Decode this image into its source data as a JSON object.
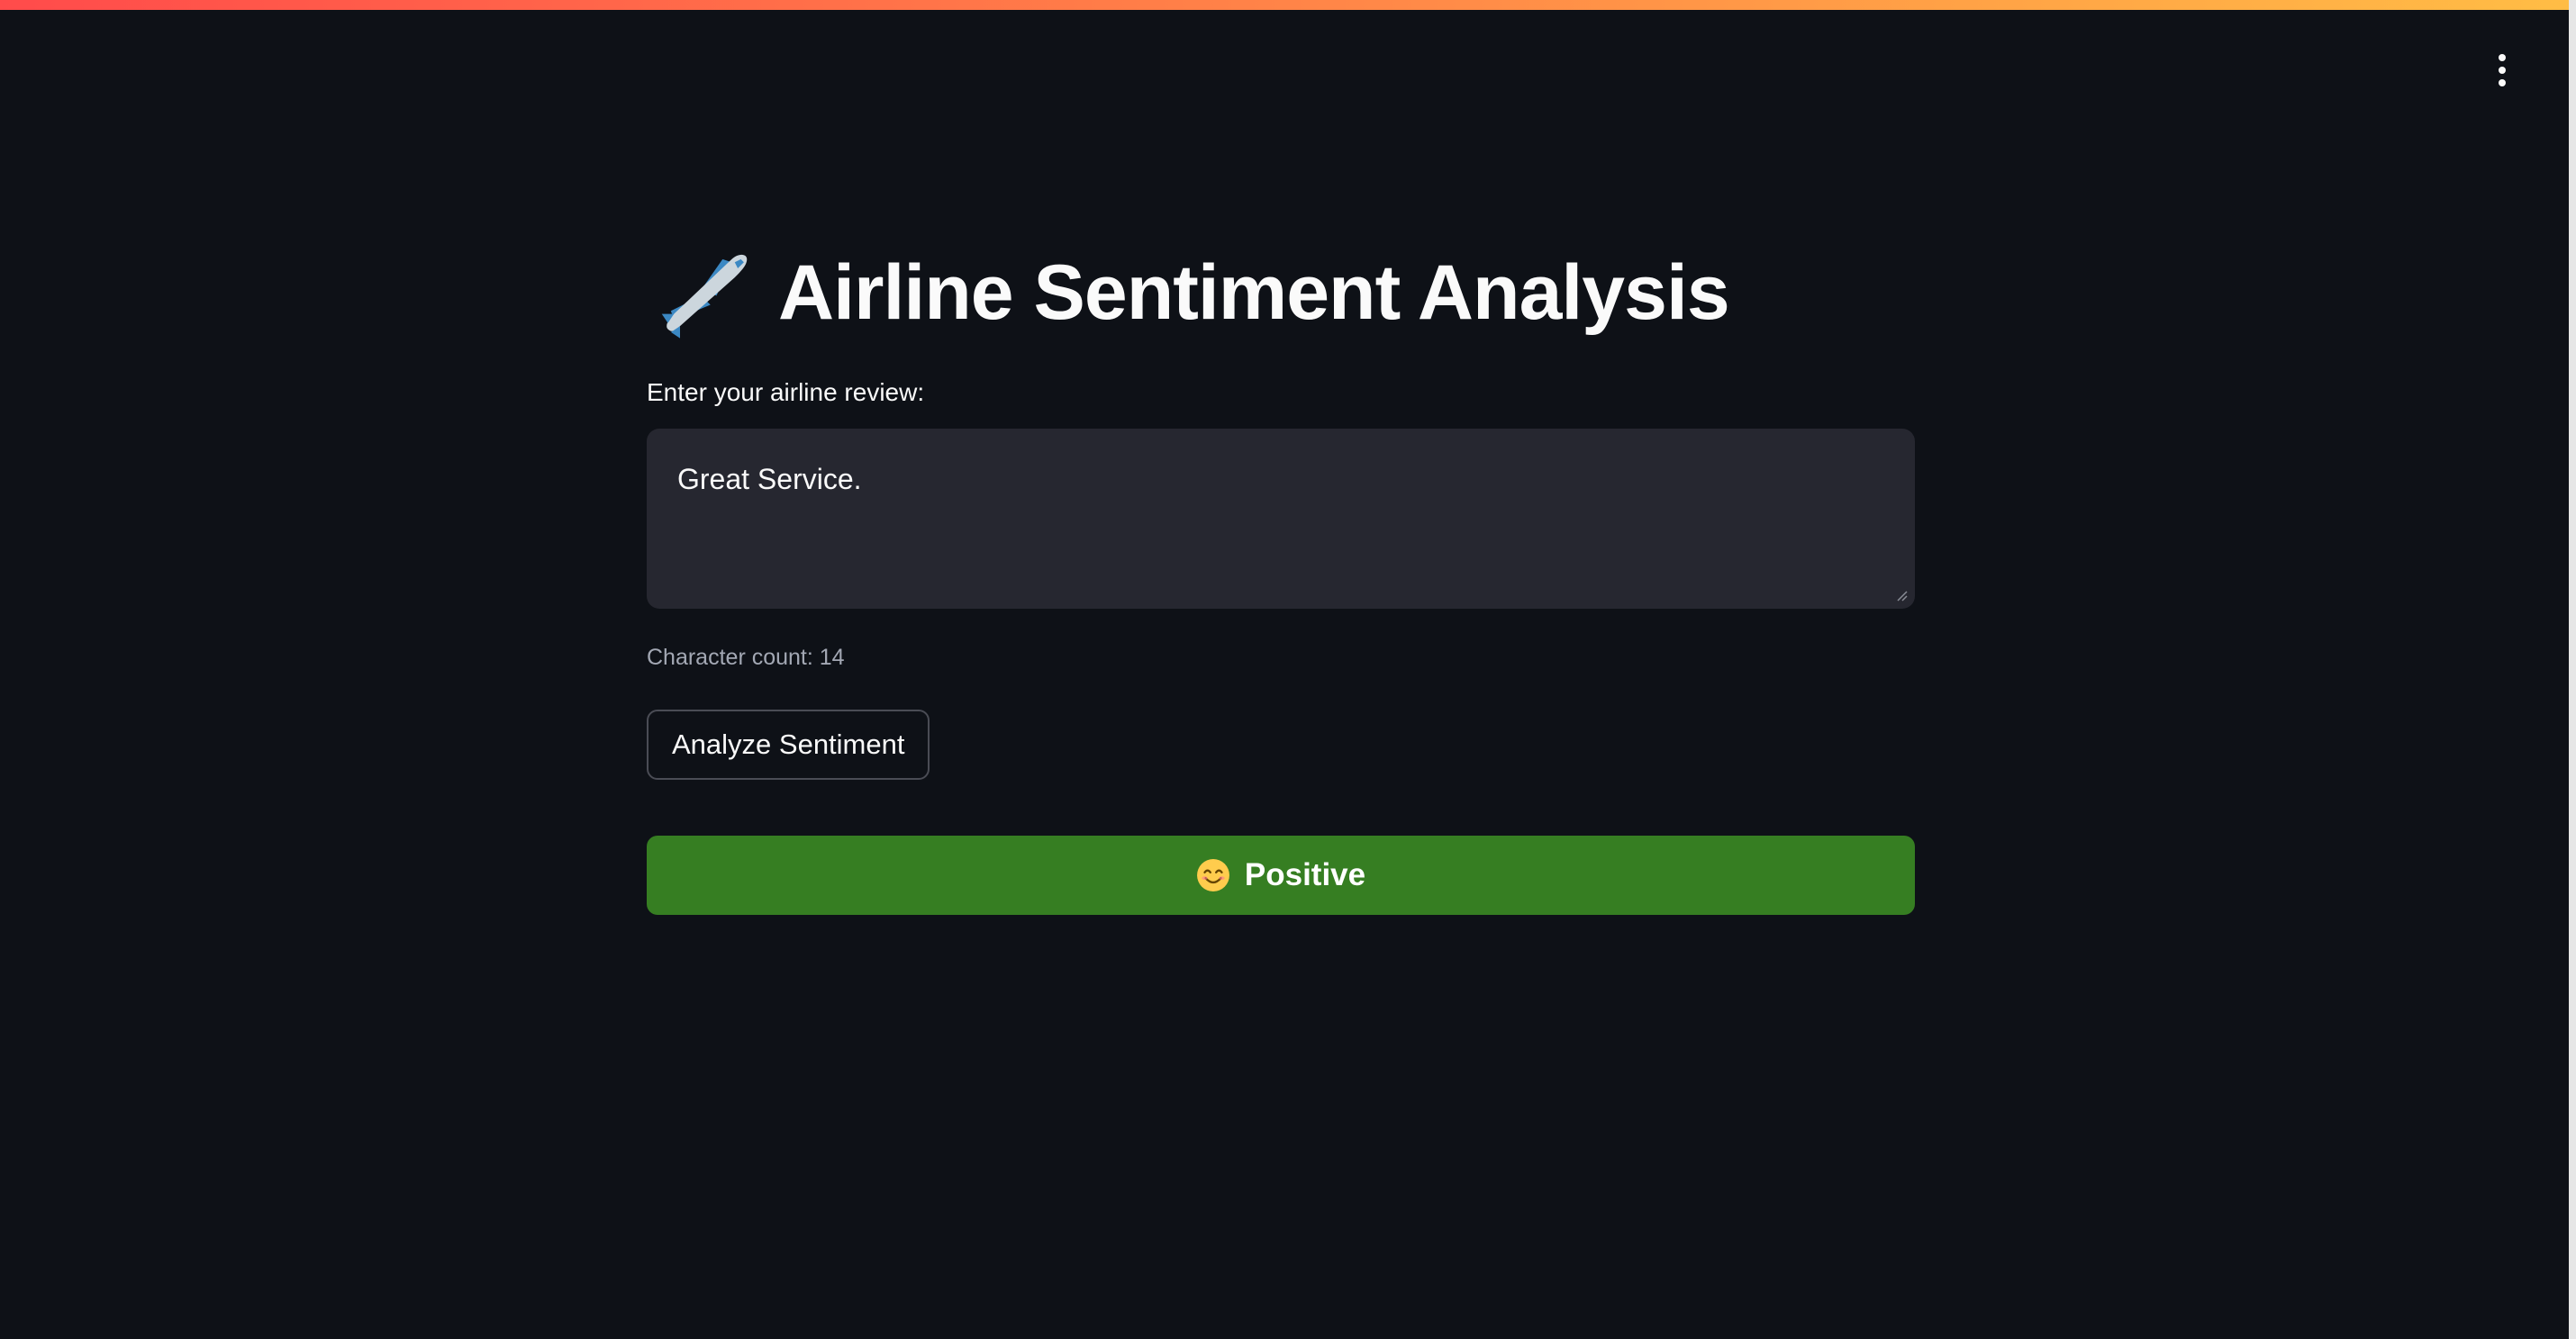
{
  "app": {
    "title_icon": "airplane-icon",
    "title": "Airline Sentiment Analysis",
    "menu_icon": "vertical-ellipsis-icon",
    "accent_gradient": [
      "#ff4b4b",
      "#ffbd45"
    ],
    "background_color": "#0e1117"
  },
  "review": {
    "label": "Enter your airline review:",
    "value": "Great Service.",
    "char_count_text": "Character count: 14"
  },
  "actions": {
    "analyze_label": "Analyze Sentiment"
  },
  "result": {
    "emoji_icon": "smiling-face-icon",
    "label": "Positive",
    "color": "#367e22"
  }
}
